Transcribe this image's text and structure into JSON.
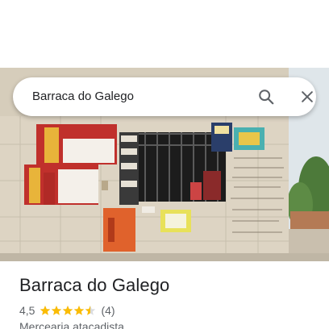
{
  "search": {
    "query": "Barraca do Galego",
    "search_icon": "search-icon",
    "close_icon": "close-icon"
  },
  "place": {
    "name": "Barraca do Galego",
    "rating": "4,5",
    "rating_value": 4.5,
    "rating_max": 5,
    "review_count": "(4)",
    "category": "Mercearia atacadista"
  },
  "colors": {
    "star": "#fbbc04",
    "text_primary": "#202124",
    "text_secondary": "#5f6368"
  }
}
